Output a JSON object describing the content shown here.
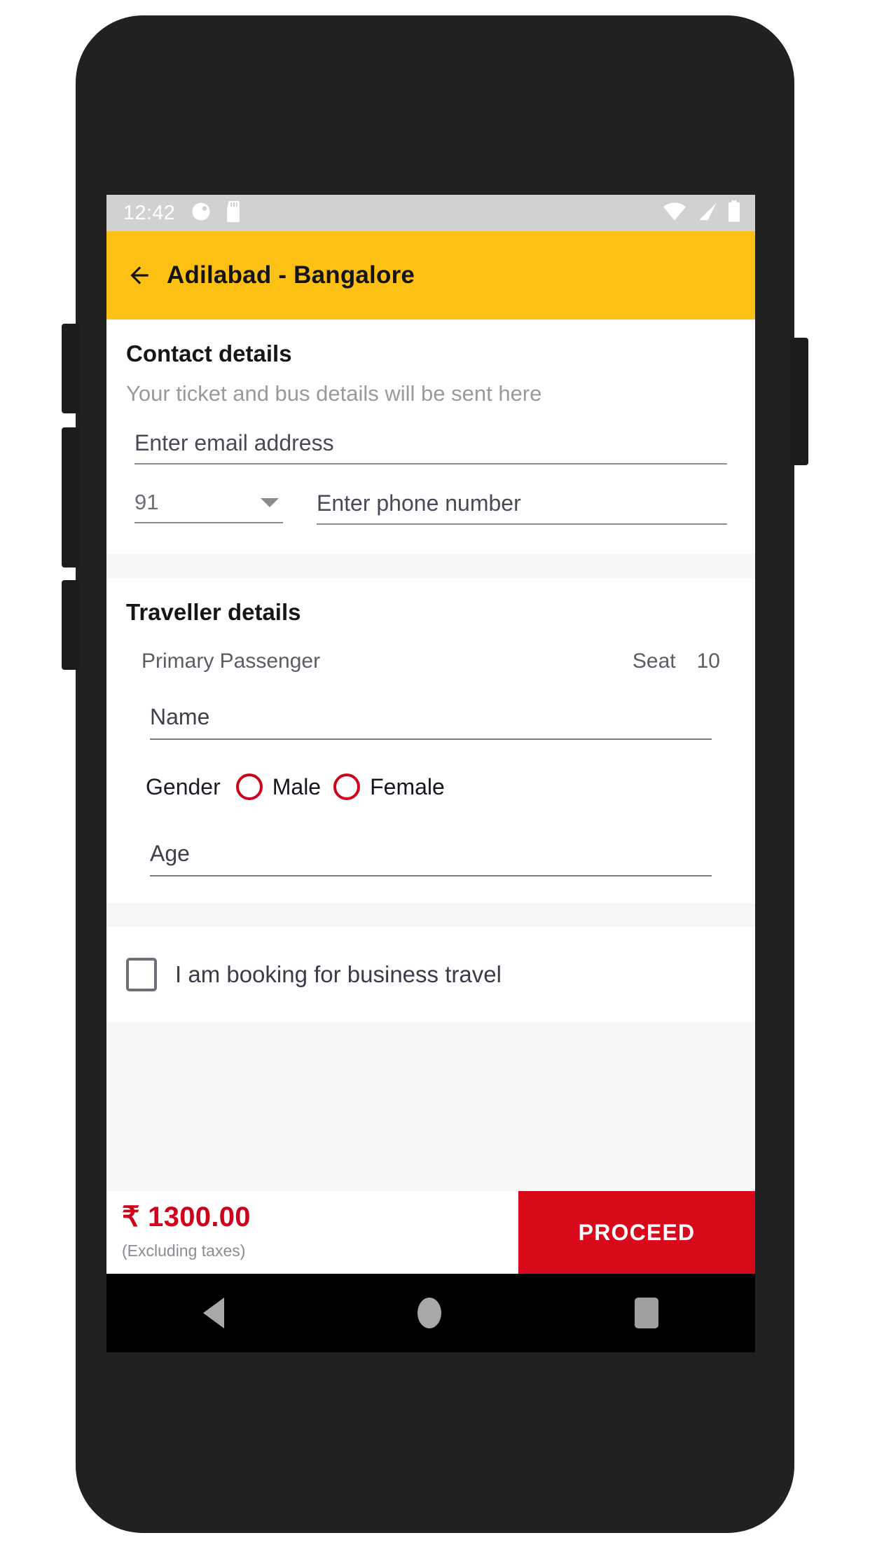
{
  "status_bar": {
    "time": "12:42",
    "left_icons": [
      "do-not-disturb-icon",
      "sd-card-icon"
    ],
    "right_icons": [
      "wifi-icon",
      "cellular-signal-icon",
      "battery-icon"
    ],
    "background_color": "#d1d1d1"
  },
  "app_bar": {
    "back_icon": "back-arrow-icon",
    "title": "Adilabad - Bangalore",
    "background_color": "#fdc014",
    "text_color": "#141414"
  },
  "contact": {
    "title": "Contact details",
    "subtitle": "Your ticket and bus details will be sent here",
    "email": {
      "value": "",
      "placeholder": "Enter email address"
    },
    "country_code": {
      "value": "91",
      "dropdown_icon": "chevron-down-icon"
    },
    "phone": {
      "value": "",
      "placeholder": "Enter phone number"
    }
  },
  "traveller": {
    "title": "Traveller details",
    "passenger_label": "Primary Passenger",
    "seat_label": "Seat",
    "seat_number": "10",
    "name": {
      "value": "",
      "placeholder": "Name"
    },
    "gender": {
      "label": "Gender",
      "options": [
        {
          "label": "Male",
          "selected": false
        },
        {
          "label": "Female",
          "selected": false
        }
      ],
      "radio_color": "#d0021b"
    },
    "age": {
      "value": "",
      "placeholder": "Age"
    }
  },
  "business_travel": {
    "label": "I am booking for business travel",
    "checked": false
  },
  "bottom_bar": {
    "currency_symbol": "₹",
    "price": "₹ 1300.00",
    "price_note": "(Excluding taxes)",
    "price_color": "#d0021b",
    "proceed_label": "PROCEED",
    "proceed_color": "#d8091a"
  },
  "nav_bar": {
    "back_icon": "nav-back-icon",
    "home_icon": "nav-home-icon",
    "recents_icon": "nav-recents-icon"
  }
}
